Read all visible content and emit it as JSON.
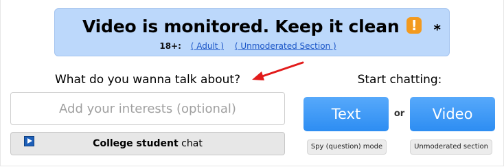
{
  "banner": {
    "title": "Video is monitored. Keep it clean",
    "warning_icon": "exclamation-icon",
    "warning_glyph": "!",
    "star": "*",
    "age_label": "18+:",
    "adult_link": "( Adult )",
    "unmoderated_link": "( Unmoderated Section )"
  },
  "interests": {
    "question": "What do you wanna talk about?",
    "placeholder": "Add your interests (optional)",
    "value": "",
    "college_bold": "College student",
    "college_rest": " chat",
    "college_icon": "play-icon"
  },
  "start": {
    "label": "Start chatting:",
    "text_button": "Text",
    "or_label": "or",
    "video_button": "Video",
    "spy_button": "Spy (question) mode",
    "unmoderated_button": "Unmoderated section"
  },
  "colors": {
    "banner_bg": "#bcd8fb",
    "button_blue": "#3b97f6",
    "warning_orange": "#f39a1e",
    "link_blue": "#1a55c7",
    "arrow_red": "#e21b1b"
  }
}
